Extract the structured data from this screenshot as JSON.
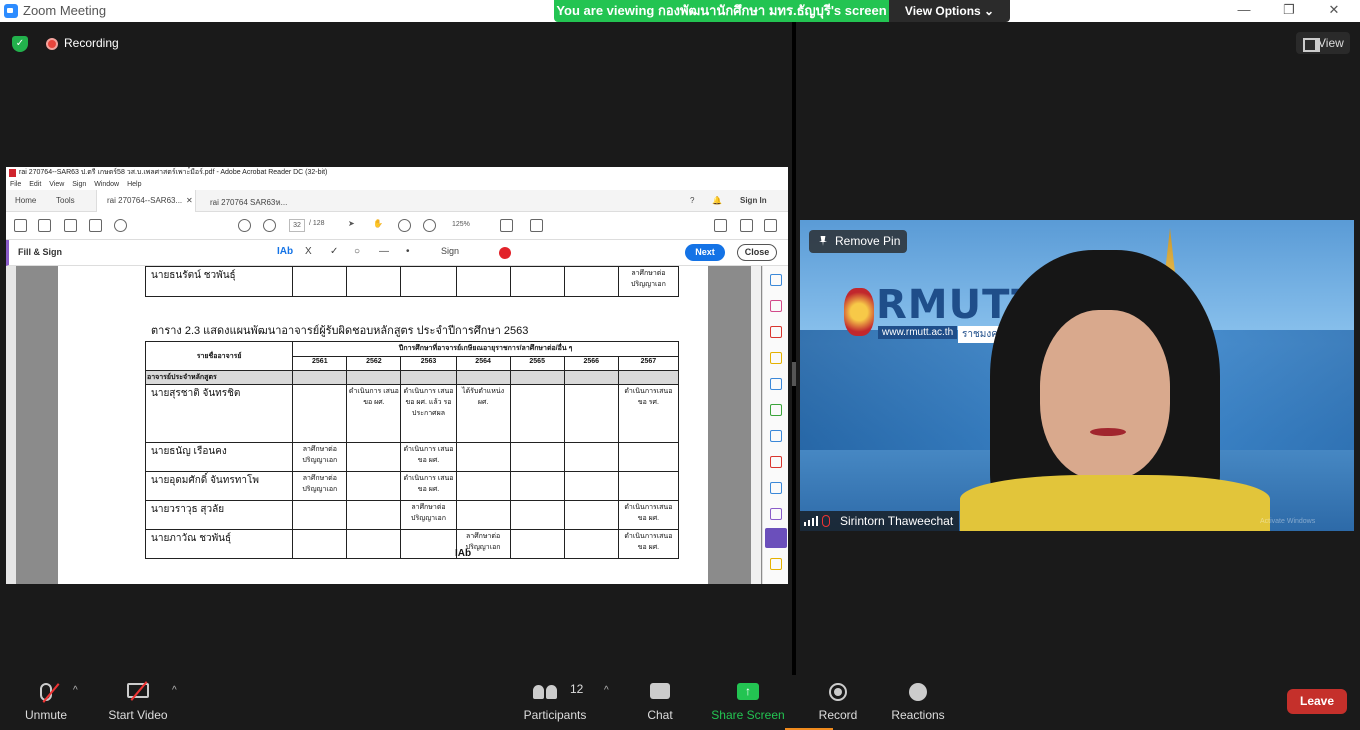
{
  "window": {
    "title": "Zoom Meeting",
    "minimize": "—",
    "maximize": "❐",
    "close": "✕"
  },
  "banner": {
    "viewing_text": "You are viewing กองพัฒนานักศึกษา มทร.ธัญบุรี's screen",
    "view_options": "View Options ⌄"
  },
  "status": {
    "recording_label": "Recording",
    "view_label": "View"
  },
  "acrobat": {
    "title": "rai 270764--SAR63 ป.ตรี เกษตร์58 วส.บ.เพลศาสตร์เพาะ์มือร์.pdf - Adobe Acrobat Reader DC (32-bit)",
    "menu": [
      "File",
      "Edit",
      "View",
      "Sign",
      "Window",
      "Help"
    ],
    "tab_home": "Home",
    "tab_tools": "Tools",
    "tab_doc1": "rai 270764--SAR63...",
    "tab_doc2": "rai 270764 SAR63ห...",
    "sign_in": "Sign In",
    "page_current": "32",
    "page_total": "/ 128",
    "zoom": "125%",
    "fill_sign_label": "Fill & Sign",
    "tool_text": "IAb",
    "tool_x": "X",
    "tool_check": "✓",
    "tool_sign": "Sign",
    "next": "Next",
    "close": "Close",
    "caption": "ตาราง 2.3 แสดงแผนพัฒนาอาจารย์ผู้รับผิดชอบหลักสูตร ประจำปีการศึกษา 2563",
    "top_row": {
      "name": "นายธนรัตน์ ชวพันธุ์",
      "c2567": "ลาศึกษาต่อ ปริญญาเอก"
    },
    "header_name": "รายชื่ออาจารย์",
    "header_plan": "ปีการศึกษาที่อาจารย์เกษียณอายุราชการ/ลาศึกษาต่อ/อื่น ๆ",
    "years": [
      "2561",
      "2562",
      "2563",
      "2564",
      "2565",
      "2566",
      "2567"
    ],
    "section_label": "อาจารย์ประจำหลักสูตร",
    "rows": [
      {
        "name": "นายสุรชาติ จันทรชิต",
        "cells": [
          "",
          "ดำเนินการ เสนอขอ ผศ.",
          "ดำเนินการ เสนอขอ ผศ. แล้ว รอ ประกาศผล",
          "ได้รับตำแหน่ง ผศ.",
          "",
          "",
          "ดำเนินการเสนอ ขอ รศ."
        ]
      },
      {
        "name": "นายธนัญ เรือนคง",
        "cells": [
          "ลาศึกษาต่อ ปริญญาเอก",
          "",
          "ดำเนินการ เสนอขอ ผศ.",
          "",
          "",
          "",
          ""
        ]
      },
      {
        "name": "นายอุดมศักดิ์ จันทรทาโพ",
        "cells": [
          "ลาศึกษาต่อ ปริญญาเอก",
          "",
          "ดำเนินการ เสนอขอ ผศ.",
          "",
          "",
          "",
          ""
        ]
      },
      {
        "name": "นายวราวุธ สุวลัย",
        "cells": [
          "",
          "",
          "ลาศึกษาต่อ ปริญญาเอก",
          "",
          "",
          "",
          "ดำเนินการเสนอ ขอ ผศ."
        ]
      },
      {
        "name": "นายภาวัณ ชวพันธุ์",
        "cells": [
          "",
          "",
          "",
          "ลาศึกษาต่อ ปริญญาเอก",
          "",
          "",
          "ดำเนินการเสนอ ขอ ผศ."
        ]
      }
    ],
    "cursor_text": "IAb"
  },
  "video": {
    "remove_pin": "Remove Pin",
    "participant_name": "Sirintorn Thaweechat",
    "logo_text": "RMUTT",
    "logo_url": "www.rmutt.ac.th",
    "logo_thai": "ราชมงคลธัญบุรี",
    "watermark": "Activate Windows"
  },
  "toolbar": {
    "unmute": "Unmute",
    "start_video": "Start Video",
    "participants": "Participants",
    "participants_count": "12",
    "chat": "Chat",
    "share_screen": "Share Screen",
    "record": "Record",
    "reactions": "Reactions",
    "leave": "Leave",
    "caret": "^"
  },
  "colors": {
    "accent_green": "#23c452",
    "leave_red": "#c5302b",
    "acrobat_blue": "#1473e6",
    "fill_sign_purple": "#8a5cc9"
  }
}
